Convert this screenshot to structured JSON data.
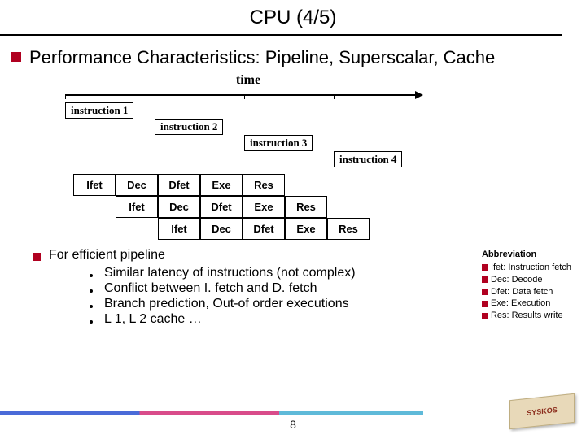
{
  "title": "CPU (4/5)",
  "subhead": "Performance Characteristics: Pipeline, Superscalar, Cache",
  "timeline": {
    "axis_label": "time",
    "instructions": [
      "instruction 1",
      "instruction 2",
      "instruction 3",
      "instruction 4"
    ]
  },
  "stages": {
    "row1": [
      "Ifet",
      "Dec",
      "Dfet",
      "Exe",
      "Res"
    ],
    "row2": [
      "Ifet",
      "Dec",
      "Dfet",
      "Exe",
      "Res"
    ],
    "row3": [
      "Ifet",
      "Dec",
      "Dfet",
      "Exe",
      "Res"
    ]
  },
  "abbrev": {
    "title": "Abbreviation",
    "items": [
      "Ifet: Instruction fetch",
      "Dec: Decode",
      "Dfet: Data fetch",
      "Exe: Execution",
      "Res: Results write"
    ]
  },
  "efficient": {
    "heading": "For efficient pipeline",
    "points": [
      "Similar latency of instructions (not complex)",
      "Conflict between I. fetch and D. fetch",
      "Branch prediction, Out-of order executions",
      "L 1, L 2 cache …"
    ]
  },
  "page_number": "8",
  "logo_text": "SYSKOS"
}
